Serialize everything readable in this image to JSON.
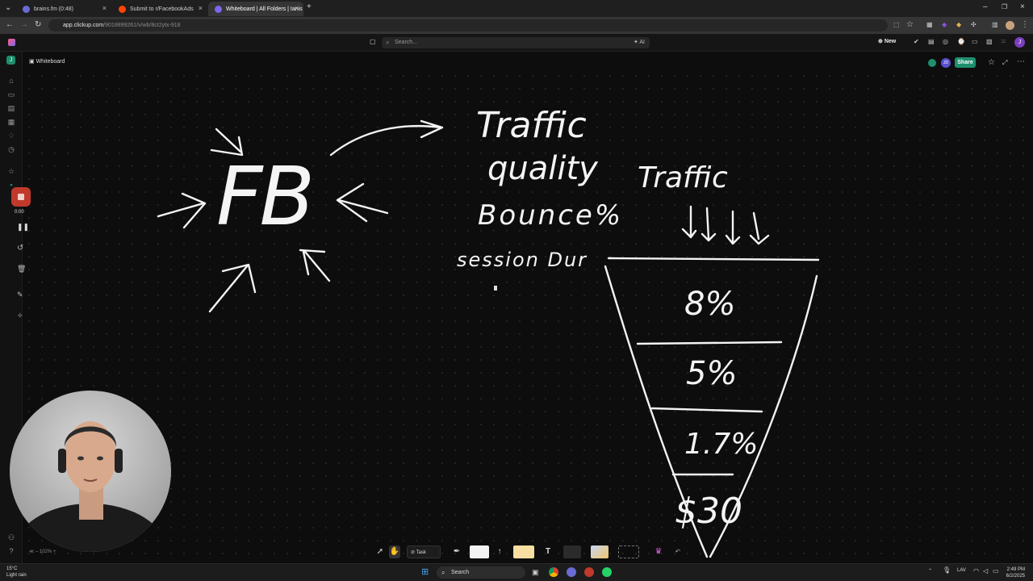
{
  "browser": {
    "tabs": [
      {
        "label": "brains.fm (0:48)",
        "active": false
      },
      {
        "label": "Submit to r/FacebookAds",
        "active": false
      },
      {
        "label": "Whiteboard | All Folders | Ianis",
        "active": true
      }
    ],
    "url_host": "app.clickup.com",
    "url_path": "/9018899261/v/wb/8ct2ytx-918"
  },
  "app": {
    "search_placeholder": "Search...",
    "ai_label": "AI",
    "new_label": "New",
    "avatar_initial": "J",
    "workspace_initial": "J",
    "page_title": "Whiteboard",
    "share_label": "Share",
    "collab_initials": "JD"
  },
  "recorder": {
    "time": "0:00"
  },
  "whiteboard": {
    "fb_letters": "FB",
    "words": {
      "traffic": "Traffic",
      "quality": "quality",
      "bounce": "Bounce%",
      "session": "session Dur",
      "traffic2": "Traffic"
    },
    "funnel_stages": [
      "8%",
      "5%",
      "1.7%",
      "$30"
    ]
  },
  "toolbar": {
    "zoom": "102%",
    "task_label": "Task",
    "text_tool": "T"
  },
  "taskbar": {
    "temp": "15°C",
    "weather": "Light rain",
    "search_label": "Search",
    "lang": "LAV",
    "time": "2:49 PM",
    "date": "6/2/2025"
  },
  "colors": {
    "accent": "#1e8f6e",
    "record": "#c0392b",
    "avatar": "#7b3fbf"
  }
}
